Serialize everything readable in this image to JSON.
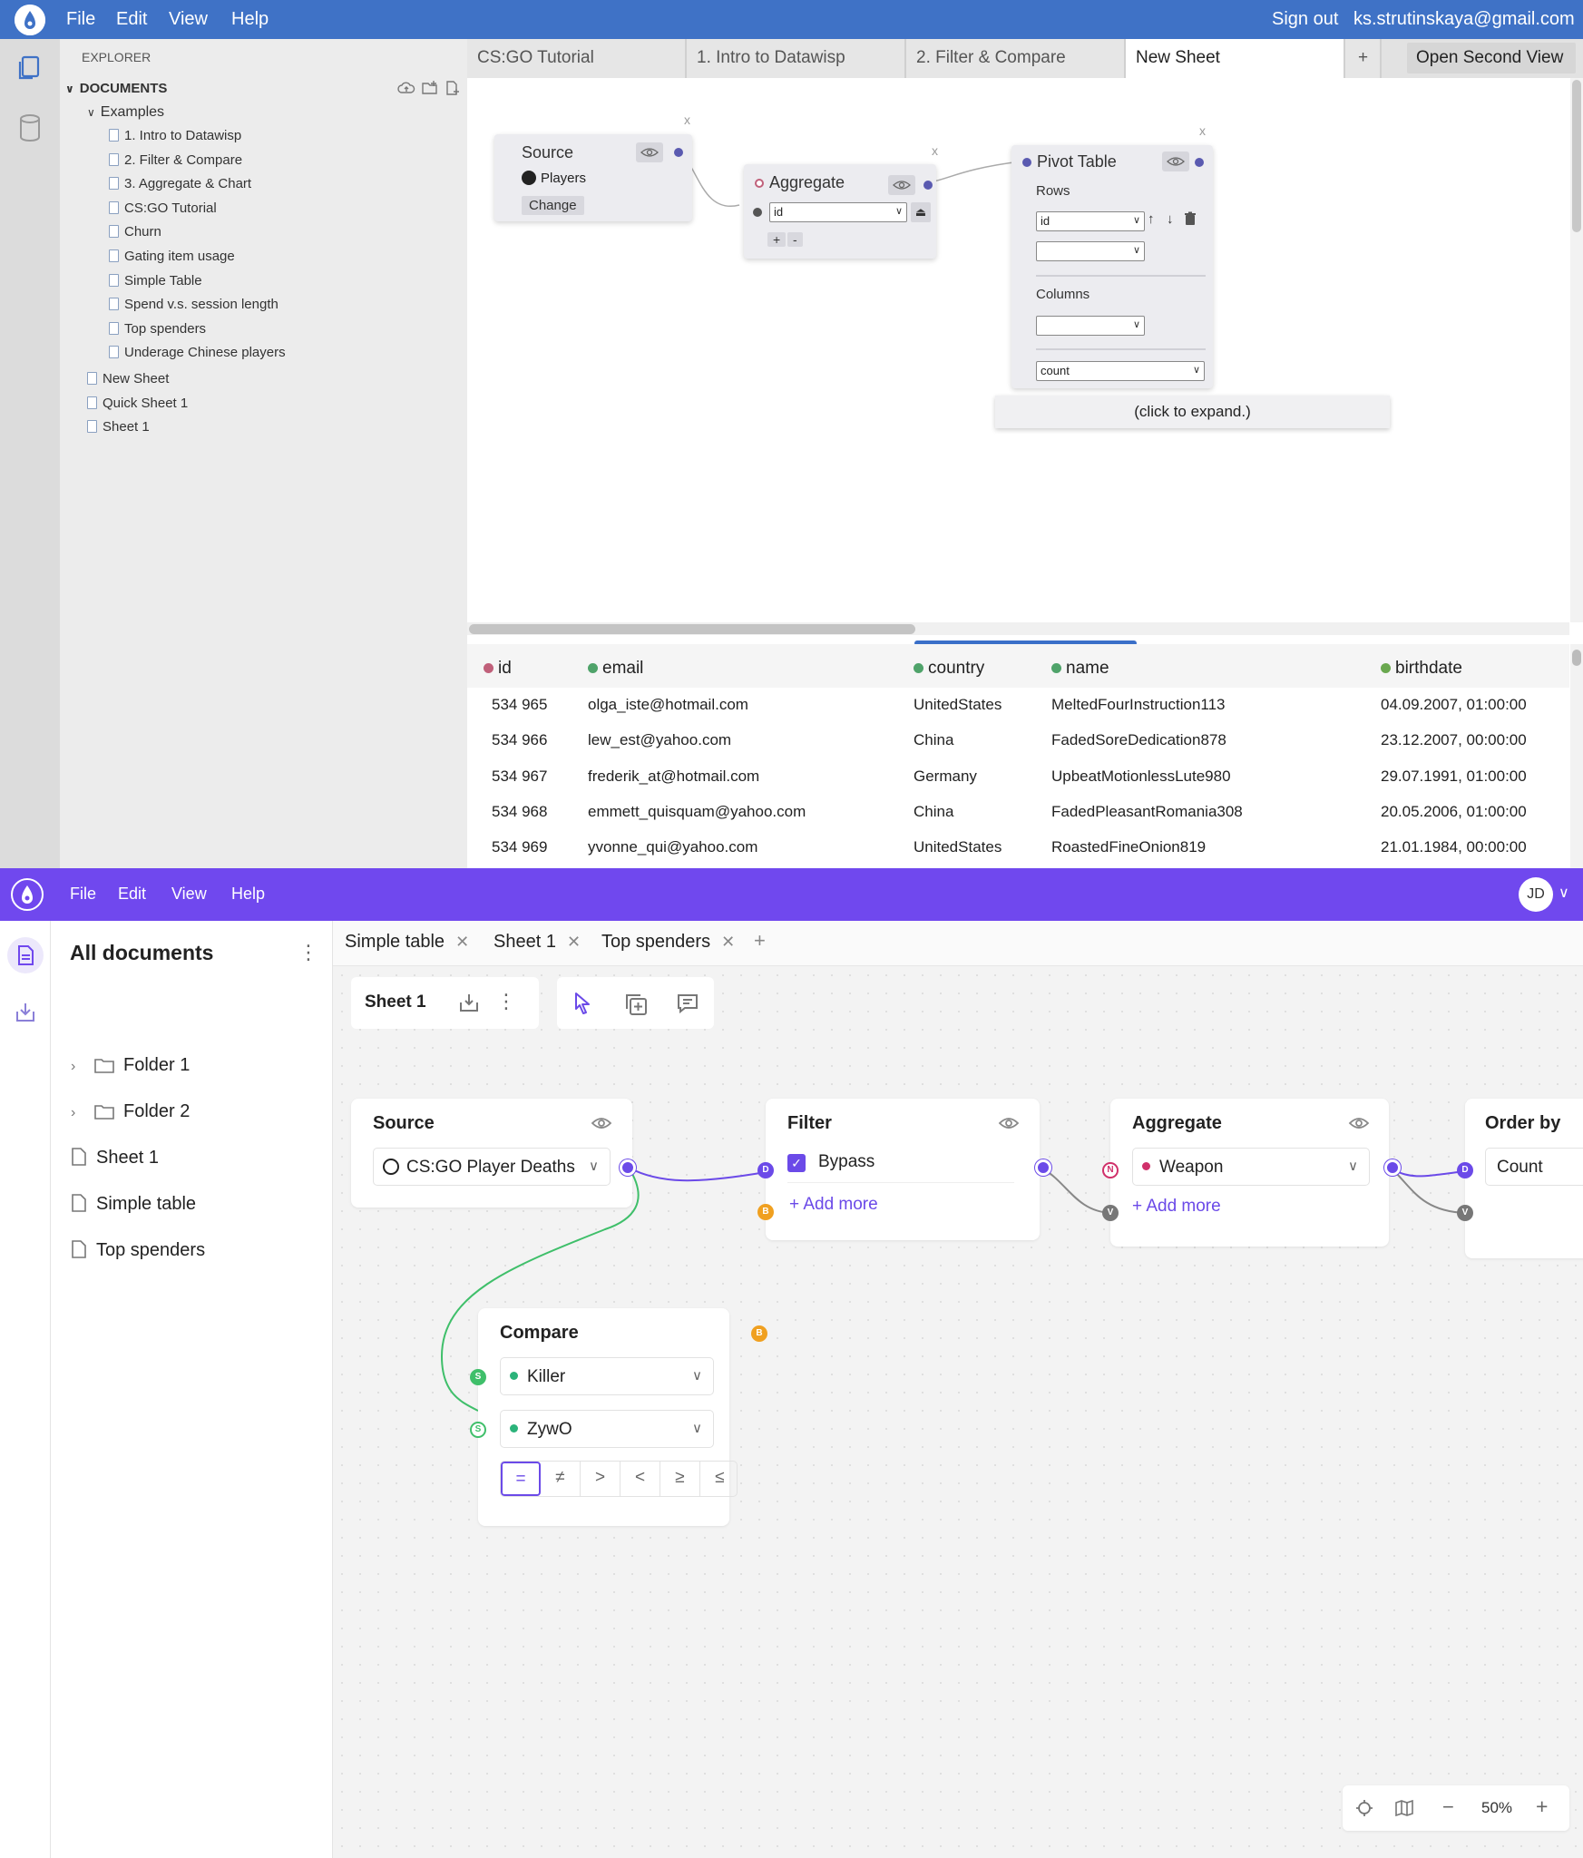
{
  "top_app": {
    "menu": [
      "File",
      "Edit",
      "View",
      "Help"
    ],
    "sign_out": "Sign out",
    "user_email": "ks.strutinskaya@gmail.com",
    "explorer_label": "EXPLORER",
    "documents_label": "DOCUMENTS",
    "examples_label": "Examples",
    "examples": [
      "1. Intro to Datawisp",
      "2. Filter & Compare",
      "3. Aggregate & Chart",
      "CS:GO Tutorial",
      "Churn",
      "Gating item usage",
      "Simple Table",
      "Spend v.s. session length",
      "Top spenders",
      "Underage Chinese players"
    ],
    "root_docs": [
      "New Sheet",
      "Quick Sheet 1",
      "Sheet 1"
    ],
    "tabs": [
      "CS:GO Tutorial",
      "1. Intro to Datawisp",
      "2. Filter & Compare",
      "New Sheet"
    ],
    "add_tab": "+",
    "open_second_view": "Open Second View",
    "nodes": {
      "source": {
        "title": "Source",
        "dataset": "Players",
        "change_label": "Change"
      },
      "aggregate": {
        "title": "Aggregate",
        "field": "id",
        "plus": "+",
        "minus": "-"
      },
      "pivot": {
        "title": "Pivot Table",
        "rows_label": "Rows",
        "row_field": "id",
        "columns_label": "Columns",
        "value": "count",
        "expand": "(click to expand.)"
      },
      "close": "x"
    },
    "table": {
      "columns": [
        {
          "name": "id",
          "color": "#c0607a"
        },
        {
          "name": "email",
          "color": "#4fa36a"
        },
        {
          "name": "country",
          "color": "#4fa36a"
        },
        {
          "name": "name",
          "color": "#4fa36a"
        },
        {
          "name": "birthdate",
          "color": "#6aa84f"
        }
      ],
      "rows": [
        [
          "534 965",
          "olga_iste@hotmail.com",
          "UnitedStates",
          "MeltedFourInstruction113",
          "04.09.2007, 01:00:00"
        ],
        [
          "534 966",
          "lew_est@yahoo.com",
          "China",
          "FadedSoreDedication878",
          "23.12.2007, 00:00:00"
        ],
        [
          "534 967",
          "frederik_at@hotmail.com",
          "Germany",
          "UpbeatMotionlessLute980",
          "29.07.1991, 01:00:00"
        ],
        [
          "534 968",
          "emmett_quisquam@yahoo.com",
          "China",
          "FadedPleasantRomania308",
          "20.05.2006, 01:00:00"
        ],
        [
          "534 969",
          "yvonne_qui@yahoo.com",
          "UnitedStates",
          "RoastedFineOnion819",
          "21.01.1984, 00:00:00"
        ]
      ]
    }
  },
  "bottom_app": {
    "menu": [
      "File",
      "Edit",
      "View",
      "Help"
    ],
    "avatar": "JD",
    "sidebar_title": "All documents",
    "folders": [
      "Folder 1",
      "Folder 2"
    ],
    "documents": [
      "Sheet 1",
      "Simple table",
      "Top spenders"
    ],
    "tabs": [
      "Simple table",
      "Sheet 1",
      "Top spenders"
    ],
    "tab_close": "✕",
    "add_tab": "+",
    "sheet_name": "Sheet 1",
    "nodes": {
      "source": {
        "title": "Source",
        "dataset": "CS:GO Player Deaths"
      },
      "filter": {
        "title": "Filter",
        "bypass": "Bypass",
        "add_more": "+ Add more"
      },
      "aggregate": {
        "title": "Aggregate",
        "field": "Weapon",
        "add_more": "+ Add more"
      },
      "order_by": {
        "title": "Order by",
        "field": "Count"
      },
      "compare": {
        "title": "Compare",
        "left": "Killer",
        "right": "ZywO",
        "ops": [
          "=",
          "≠",
          ">",
          "<",
          "≥",
          "≤"
        ]
      }
    },
    "ports": {
      "d": "D",
      "b": "B",
      "n": "N",
      "v": "V",
      "s": "S"
    },
    "zoom": "50%",
    "zoom_minus": "−",
    "zoom_plus": "+",
    "colors": {
      "accent": "#7048ee",
      "top_bar": "#3f72c6",
      "green": "#3fbf6a",
      "orange": "#f0a020",
      "red": "#d0306a"
    }
  }
}
